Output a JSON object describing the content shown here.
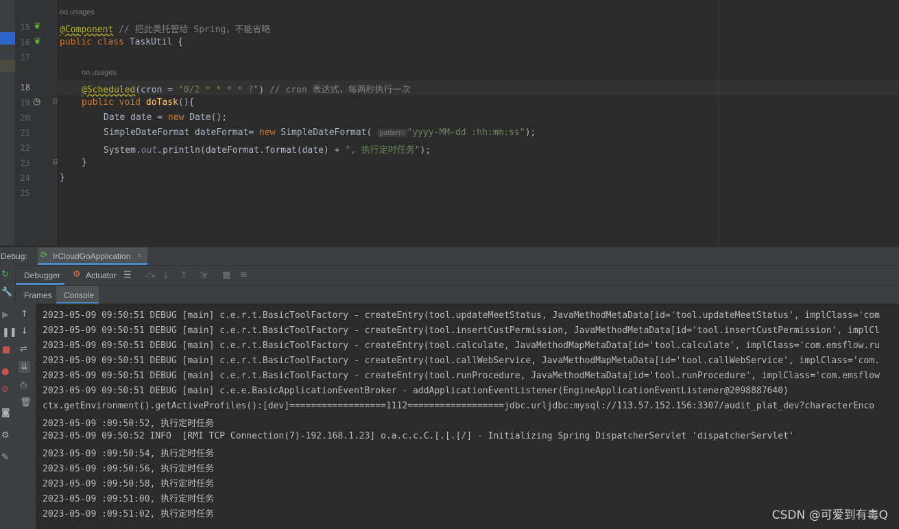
{
  "editor": {
    "line_numbers": [
      "15",
      "16",
      "17",
      "18",
      "19",
      "20",
      "21",
      "22",
      "23",
      "24",
      "25"
    ],
    "usage_hint_1": "no usages",
    "usage_hint_2": "no usages",
    "l15_ann": "@Component",
    "l15_comment": " // 把此类托管给 Spring，不能省略",
    "l16_kw": "public class",
    "l16_rest": " TaskUtil {",
    "l18_ann": "@Scheduled",
    "l18_a": "(cron = ",
    "l18_str": "\"0/2 * * * * ?\"",
    "l18_b": ") ",
    "l18_comment": "// cron 表达式，每两秒执行一次",
    "l19_kw": "public void",
    "l19_fn": " doTask",
    "l19_rest": "(){",
    "l20_a": "Date date = ",
    "l20_kw": "new",
    "l20_b": " Date();",
    "l21_a": "SimpleDateFormat dateFormat= ",
    "l21_kw": "new",
    "l21_b": " SimpleDateFormat( ",
    "l21_hint": "pattern:",
    "l21_str": "\"yyyy-MM-dd :hh:mm:ss\"",
    "l21_c": ");",
    "l22_a": "System.",
    "l22_out": "out",
    "l22_b": ".println(dateFormat.format(date) + ",
    "l22_str": "\", 执行定时任务\"",
    "l22_c": ");",
    "l23": "}",
    "l24": "}"
  },
  "debug": {
    "label": "Debug:",
    "config_tab": "IrCloudGoApplication",
    "tab_debugger": "Debugger",
    "tab_actuator": "Actuator",
    "tab_frames": "Frames",
    "tab_console": "Console"
  },
  "console_lines": [
    "2023-05-09 09:50:51 DEBUG [main] c.e.r.t.BasicToolFactory - createEntry(tool.updateMeetStatus, JavaMethodMetaData[id='tool.updateMeetStatus', implClass='com",
    "2023-05-09 09:50:51 DEBUG [main] c.e.r.t.BasicToolFactory - createEntry(tool.insertCustPermission, JavaMethodMetaData[id='tool.insertCustPermission', implCl",
    "2023-05-09 09:50:51 DEBUG [main] c.e.r.t.BasicToolFactory - createEntry(tool.calculate, JavaMethodMapMetaData[id='tool.calculate', implClass='com.emsflow.ru",
    "2023-05-09 09:50:51 DEBUG [main] c.e.r.t.BasicToolFactory - createEntry(tool.callWebService, JavaMethodMapMetaData[id='tool.callWebService', implClass='com.",
    "2023-05-09 09:50:51 DEBUG [main] c.e.r.t.BasicToolFactory - createEntry(tool.runProcedure, JavaMethodMetaData[id='tool.runProcedure', implClass='com.emsflow",
    "2023-05-09 09:50:51 DEBUG [main] c.e.e.BasicApplicationEventBroker - addApplicationEventListener(EngineApplicationEventListener@2098887640)",
    "ctx.getEnvironment().getActiveProfiles():[dev]==================1112==================jdbc.urljdbc:mysql://113.57.152.156:3307/audit_plat_dev?characterEnco",
    "2023-05-09 :09:50:52, 执行定时任务",
    "2023-05-09 09:50:52 INFO  [RMI TCP Connection(7)-192.168.1.23] o.a.c.c.C.[.[.[/] - Initializing Spring DispatcherServlet 'dispatcherServlet'",
    "2023-05-09 :09:50:54, 执行定时任务",
    "2023-05-09 :09:50:56, 执行定时任务",
    "2023-05-09 :09:50:58, 执行定时任务",
    "2023-05-09 :09:51:00, 执行定时任务",
    "2023-05-09 :09:51:02, 执行定时任务"
  ],
  "watermark": "CSDN @可爱到有毒Q"
}
